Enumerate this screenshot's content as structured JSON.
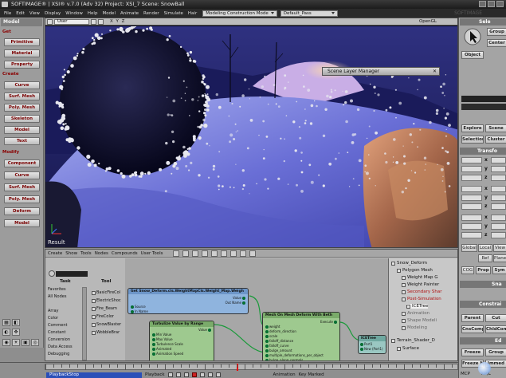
{
  "titlebar": {
    "text": "SOFTIMAGE® | XSI® v.7.0 (Adv 32) Project: XSI_7    Scene: SnowBall"
  },
  "menubar": {
    "items": [
      "File",
      "Edit",
      "View",
      "Display",
      "Window",
      "Help",
      "Model",
      "Animate",
      "Render",
      "Simulate",
      "Hair"
    ],
    "construction_mode": "Modeling Construction Mode",
    "pass": "Default_Pass",
    "watermark": "SOFTIMAGE"
  },
  "left_toolbar": {
    "header": "Model",
    "get_label": "Get",
    "get_items": [
      "Primitive",
      "Material",
      "Property"
    ],
    "create_label": "Create",
    "create_items": [
      "Curve",
      "Surf. Mesh",
      "Poly. Mesh",
      "Skeleton",
      "Model",
      "Text"
    ],
    "modify_label": "Modify",
    "modify_items": [
      "Component",
      "Curve",
      "Surf. Mesh",
      "Poly. Mesh",
      "Deform",
      "Model"
    ]
  },
  "viewport": {
    "camera": "User",
    "axes": "X Y Z",
    "renderer": "OpenGL",
    "result_label": "Result",
    "colors": {
      "sky": "#1c1d6a",
      "snow": "#6e73d8",
      "rock": "#c9805a"
    }
  },
  "scene_layer_manager": {
    "title": "Scene Layer Manager"
  },
  "right_toolbar": {
    "select_header": "Sele",
    "group_label": "Group",
    "center_label": "Center",
    "object_label": "Object",
    "explore_label": "Explore",
    "scene_label": "Scene",
    "selection_label": "Selection",
    "cluster_label": "Cluster",
    "transform_header": "Transfo",
    "axes": [
      "x",
      "y",
      "z",
      "x",
      "y",
      "z",
      "x",
      "y",
      "z"
    ],
    "global_label": "Global",
    "local_label": "Local",
    "view_label": "View",
    "ref_label": "Ref",
    "plane_label": "Plane",
    "cog_label": "COG",
    "prop_label": "Prop",
    "sym_label": "Sym",
    "snap_header": "Sna",
    "constrain_header": "Constrai",
    "parent_label": "Parent",
    "cut_label": "Cut",
    "cnscomp_label": "CnsComp",
    "childcomp_label": "ChldComp",
    "edit_header": "Ed",
    "freeze_label": "Freeze",
    "freeze_group_label": "Group",
    "freeze_m_label": "Freeze M",
    "immediate_label": "Immed",
    "mcp_label": "MCP",
    "kp_label": "KP/L"
  },
  "ice_panel": {
    "menu": [
      "Create",
      "Show",
      "Tools",
      "Nodes",
      "Compounds",
      "User Tools"
    ],
    "task_header": "Task",
    "tool_header": "Tool",
    "tasks": [
      "Favorites",
      "All Nodes",
      "",
      "Array",
      "Color",
      "Comment",
      "Constant",
      "Conversion",
      "Data Access",
      "Debugging"
    ],
    "tools": [
      "BasicFireCol",
      "ElectricShoc",
      "Fire_Beam",
      "FireColor",
      "SnowBlaster",
      "WobbleBrar"
    ],
    "nodes": {
      "get_data": {
        "title": "Get Snow_Deform.cls.WeightMapCls.Weight_Map.Weigh",
        "ports_left": [
          "Source",
          "In Name"
        ],
        "ports_right": [
          "Value",
          "Out Name"
        ]
      },
      "turbulize": {
        "title": "Turbulize Value by Range",
        "ports": [
          "Min Value",
          "Max Value",
          "Turbulence Scale",
          "Animated",
          "Animation Speed"
        ],
        "out": "Value"
      },
      "mesh_deform": {
        "title": "Mesh On Mesh Deform With Beth",
        "execute": "Execute",
        "ports": [
          "weight",
          "deform_direction",
          "scale",
          "falloff_distance",
          "falloff_curve",
          "bulge_amount",
          "multiple_deformations_per_object",
          "bulge_along_normals"
        ]
      },
      "ice_tree": {
        "title": "ICETree",
        "ports": [
          "Port1",
          "New (Port1)"
        ]
      }
    },
    "explorer": {
      "root": "Snow_Deform",
      "items": [
        "Polygon Mesh",
        "Weight Map G",
        "Weight Painter",
        "Secondary Shar",
        "Post-Simulation",
        "ICETree",
        "Animation",
        "Shape Modeli",
        "Modeling",
        "Terrain_Shader_D",
        "Surface"
      ]
    }
  },
  "timeline": {
    "playback_label": "PlaybackStop",
    "playback_btn": "Playback",
    "animation_label": "Animation",
    "keymarked": "Key Marked",
    "frame_end": "100"
  }
}
